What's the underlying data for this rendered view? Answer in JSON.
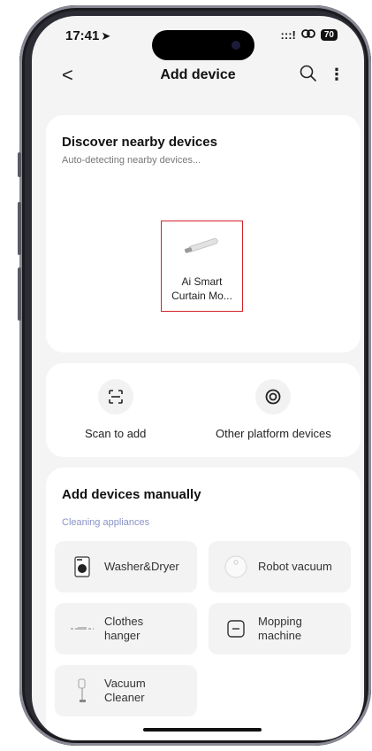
{
  "status_bar": {
    "time": "17:41",
    "location_arrow": "➤",
    "signal": ":::!",
    "battery": "70"
  },
  "nav": {
    "back": "<",
    "title": "Add device",
    "more": "⋮"
  },
  "discover": {
    "title": "Discover nearby devices",
    "subtitle": "Auto-detecting nearby devices...",
    "device": {
      "name_line1": "Ai Smart",
      "name_line2": "Curtain Mo..."
    }
  },
  "actions": [
    {
      "label": "Scan to add",
      "icon": "scan-icon"
    },
    {
      "label": "Other platform devices",
      "icon": "target-icon"
    }
  ],
  "manual": {
    "title": "Add devices manually",
    "category": "Cleaning appliances",
    "items": [
      {
        "line1": "Washer&Dryer",
        "line2": "",
        "icon": "washer-icon"
      },
      {
        "line1": "Robot vacuum",
        "line2": "",
        "icon": "robot-vacuum-icon"
      },
      {
        "line1": "Clothes",
        "line2": "hanger",
        "icon": "clothes-hanger-icon"
      },
      {
        "line1": "Mopping",
        "line2": "machine",
        "icon": "mopping-machine-icon"
      },
      {
        "line1": "Vacuum",
        "line2": "Cleaner",
        "icon": "vacuum-cleaner-icon"
      }
    ]
  },
  "colors": {
    "highlight": "#d3232a",
    "category": "#8a93c8",
    "background": "#f4f4f4"
  }
}
